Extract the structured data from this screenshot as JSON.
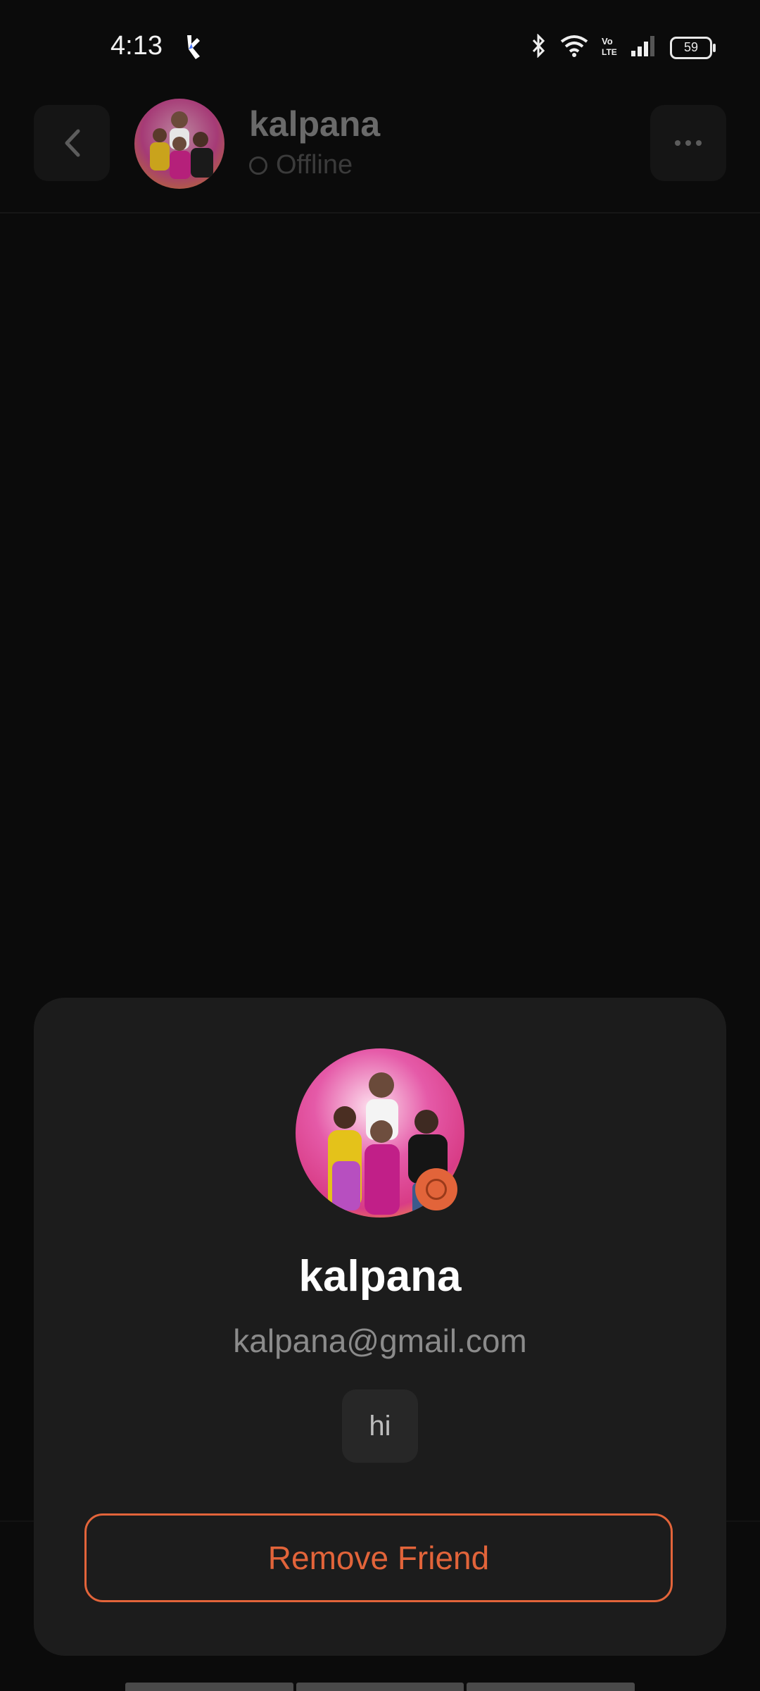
{
  "status_bar": {
    "time": "4:13",
    "battery": "59",
    "icons": [
      "app-icon",
      "bluetooth-icon",
      "wifi-icon",
      "volte-icon",
      "signal-icon",
      "battery-icon"
    ]
  },
  "header": {
    "name": "kalpana",
    "status": "Offline",
    "icons": [
      "back-icon",
      "more-icon",
      "avatar-photo"
    ]
  },
  "profile_sheet": {
    "name": "kalpana",
    "email": "kalpana@gmail.com",
    "bio": "hi",
    "remove_label": "Remove Friend",
    "accent": "#e2643a"
  }
}
